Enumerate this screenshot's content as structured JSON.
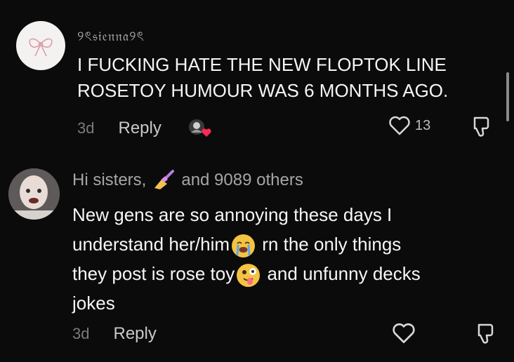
{
  "comments": [
    {
      "username": "୨ৎ𝔰𝔦𝔢𝔫𝔫𝔞୨ৎ",
      "text_lines": [
        "I FUCKING HATE THE NEW FLOPTOK LINE",
        "ROSETOY HUMOUR WAS 6 MONTHS AGO."
      ],
      "date": "3d",
      "reply_label": "Reply",
      "likes": "13",
      "avatar_icon": "bow-icon",
      "reaction_icon": "creator-liked-heart-icon"
    },
    {
      "username_prefix": "Hi sisters,",
      "username_emoji": "nail-polish-icon",
      "username_suffix": "and 9089 others",
      "text_parts": {
        "line1": "New gens are so annoying these days I",
        "line2_before": "understand her/him",
        "line2_after": "rn the only things",
        "line3_before": "they post is rose toy",
        "line3_after": "and unfunny decks",
        "line4": "jokes"
      },
      "date": "3d",
      "reply_label": "Reply",
      "avatar_icon": "face-avatar"
    }
  ],
  "colors": {
    "background": "#0b0b0b",
    "text": "#f6f6f6",
    "muted": "#7b7b7b",
    "heart_red": "#ff2a55"
  }
}
